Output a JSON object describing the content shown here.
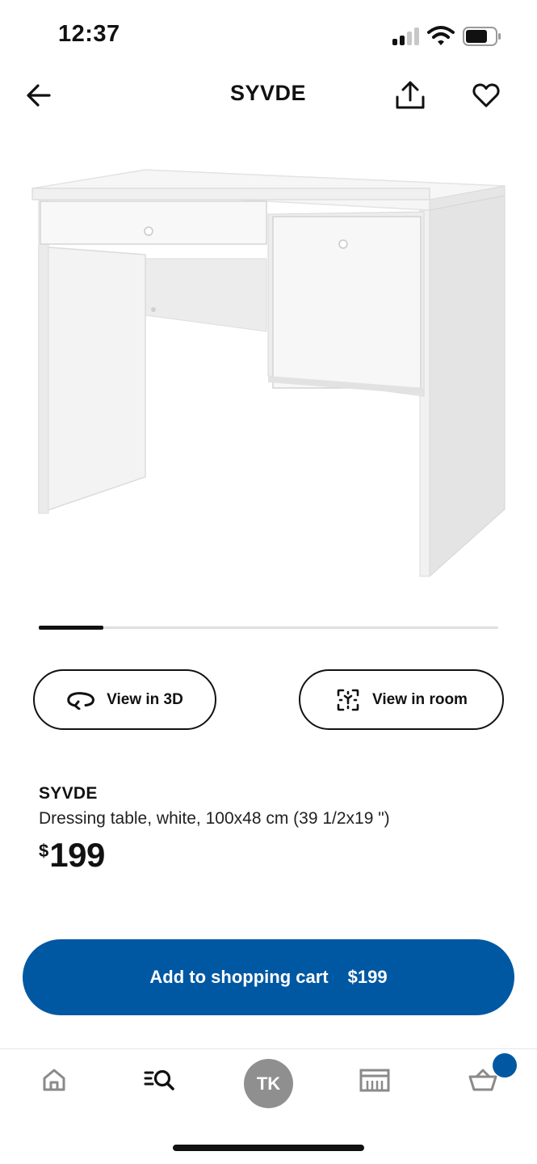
{
  "status_bar": {
    "time": "12:37"
  },
  "header": {
    "title": "SYVDE",
    "icons": [
      "back-arrow-icon",
      "share-icon",
      "heart-icon"
    ]
  },
  "carousel": {
    "progress": 0.14
  },
  "actions": {
    "view_3d": "View in 3D",
    "view_room": "View in room"
  },
  "product": {
    "name": "SYVDE",
    "description": "Dressing table, white, 100x48 cm (39 1/2x19 \")",
    "price_currency": "$",
    "price_amount": "199"
  },
  "cart_button": {
    "label": "Add to shopping cart",
    "price": "$199"
  },
  "tab_bar": {
    "avatar_initials": "TK"
  },
  "colors": {
    "accent": "#0058a3",
    "avatar_bg": "#8f8f8f"
  }
}
